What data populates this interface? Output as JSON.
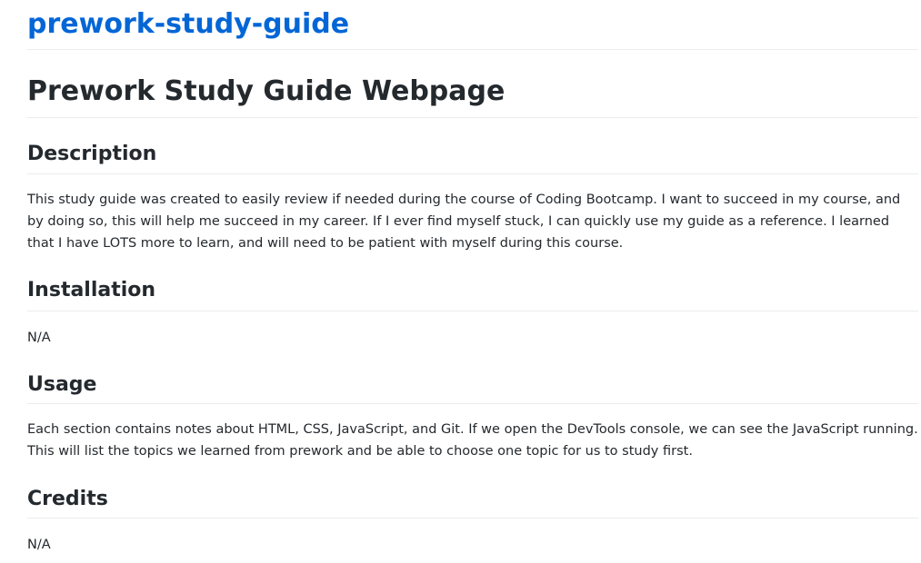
{
  "repo": {
    "title": "prework-study-guide"
  },
  "readme": {
    "title": "Prework Study Guide Webpage",
    "sections": [
      {
        "heading": "Description",
        "body": "This study guide was created to easily review if needed during the course of Coding Bootcamp. I want to succeed in my course, and by doing so, this will help me succeed in my career. If I ever find myself stuck, I can quickly use my guide as a reference. I learned that I have LOTS more to learn, and will need to be patient with myself during this course."
      },
      {
        "heading": "Installation",
        "body": "N/A"
      },
      {
        "heading": "Usage",
        "body": "Each section contains notes about HTML, CSS, JavaScript, and Git. If we open the DevTools console, we can see the JavaScript running. This will list the topics we learned from prework and be able to choose one topic for us to study first."
      },
      {
        "heading": "Credits",
        "body": "N/A"
      }
    ]
  },
  "colors": {
    "link": "#0366d6",
    "text": "#24292e",
    "divider": "#eaecef"
  }
}
